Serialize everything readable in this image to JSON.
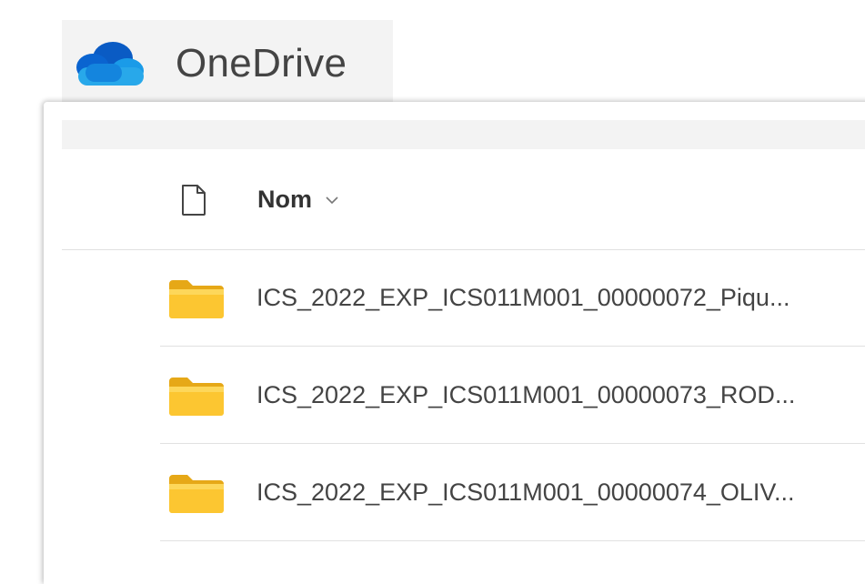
{
  "app": {
    "name": "OneDrive",
    "brand_color": "#0078d4"
  },
  "list": {
    "header": {
      "name_label": "Nom",
      "type_icon": "file-icon",
      "sort_icon": "chevron-down-icon"
    },
    "items": [
      {
        "name": "ICS_2022_EXP_ICS011M001_00000072_Piqu...",
        "icon": "folder-icon"
      },
      {
        "name": "ICS_2022_EXP_ICS011M001_00000073_ROD...",
        "icon": "folder-icon"
      },
      {
        "name": "ICS_2022_EXP_ICS011M001_00000074_OLIV...",
        "icon": "folder-icon"
      }
    ]
  }
}
